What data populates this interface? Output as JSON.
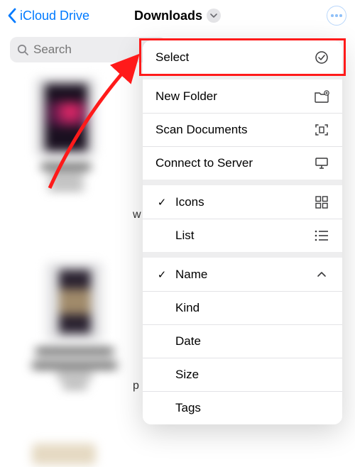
{
  "header": {
    "back_label": "iCloud Drive",
    "title": "Downloads"
  },
  "search": {
    "placeholder": "Search"
  },
  "menu": {
    "select": "Select",
    "new_folder": "New Folder",
    "scan": "Scan Documents",
    "connect": "Connect to Server",
    "view_icons": "Icons",
    "view_list": "List",
    "sort_name": "Name",
    "sort_kind": "Kind",
    "sort_date": "Date",
    "sort_size": "Size",
    "sort_tags": "Tags"
  }
}
